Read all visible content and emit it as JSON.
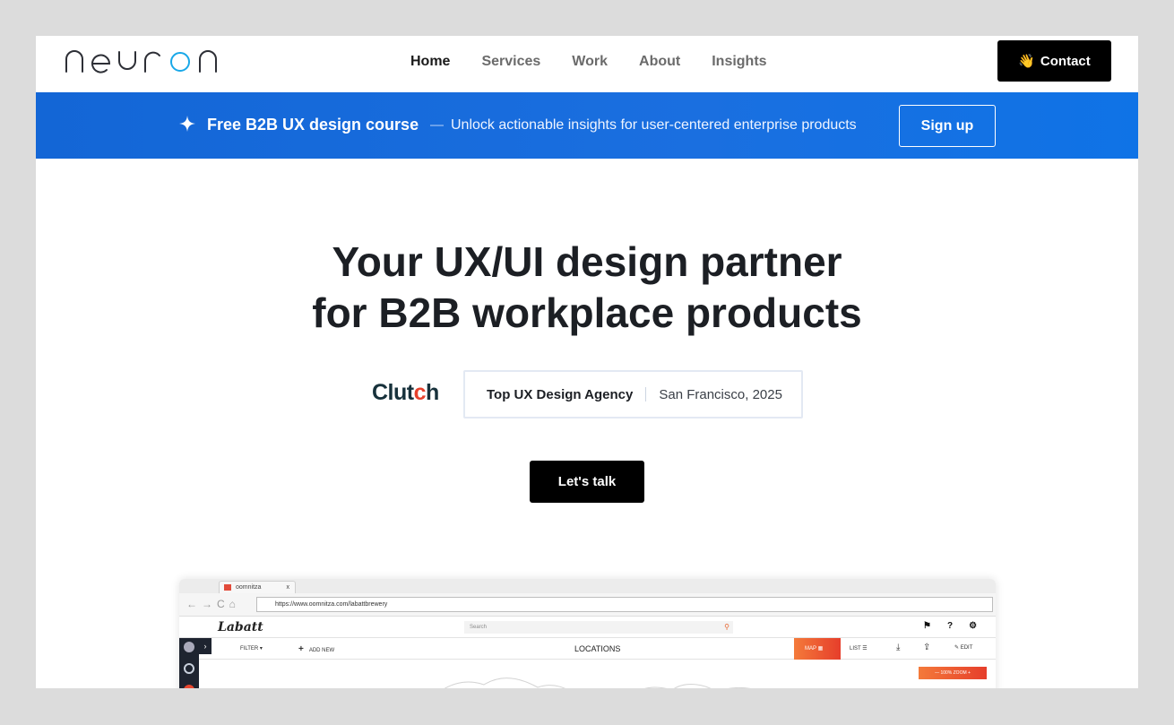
{
  "header": {
    "logo_text": "neuron",
    "nav": [
      "Home",
      "Services",
      "Work",
      "About",
      "Insights"
    ],
    "active_nav": "Home",
    "contact_emoji": "👋",
    "contact_label": "Contact"
  },
  "banner": {
    "icon": "sparkle-icon",
    "title": "Free B2B UX design course",
    "dash": "—",
    "text": "Unlock actionable insights for user-centered enterprise products",
    "signup_label": "Sign up",
    "color": "#1a6fe0"
  },
  "hero": {
    "title_line1": "Your UX/UI design partner",
    "title_line2": "for B2B workplace products",
    "clutch_logo": "Clutch",
    "badge_primary": "Top UX Design Agency",
    "badge_secondary": "San Francisco, 2025",
    "cta_label": "Let's talk"
  },
  "mock": {
    "tab_title": "oomnitza",
    "tab_close": "x",
    "url": "https://www.oomnitza.com/labattbrewery",
    "brand": "Labatt",
    "search_placeholder": "Search",
    "filter_label": "FILTER ▾",
    "add_label": "ADD NEW",
    "section_title": "LOCATIONS",
    "map_label": "MAP",
    "list_label": "LIST",
    "edit_label": "EDIT",
    "zoom_label": "— 100% ZOOM +",
    "accent": "#e8472f"
  }
}
